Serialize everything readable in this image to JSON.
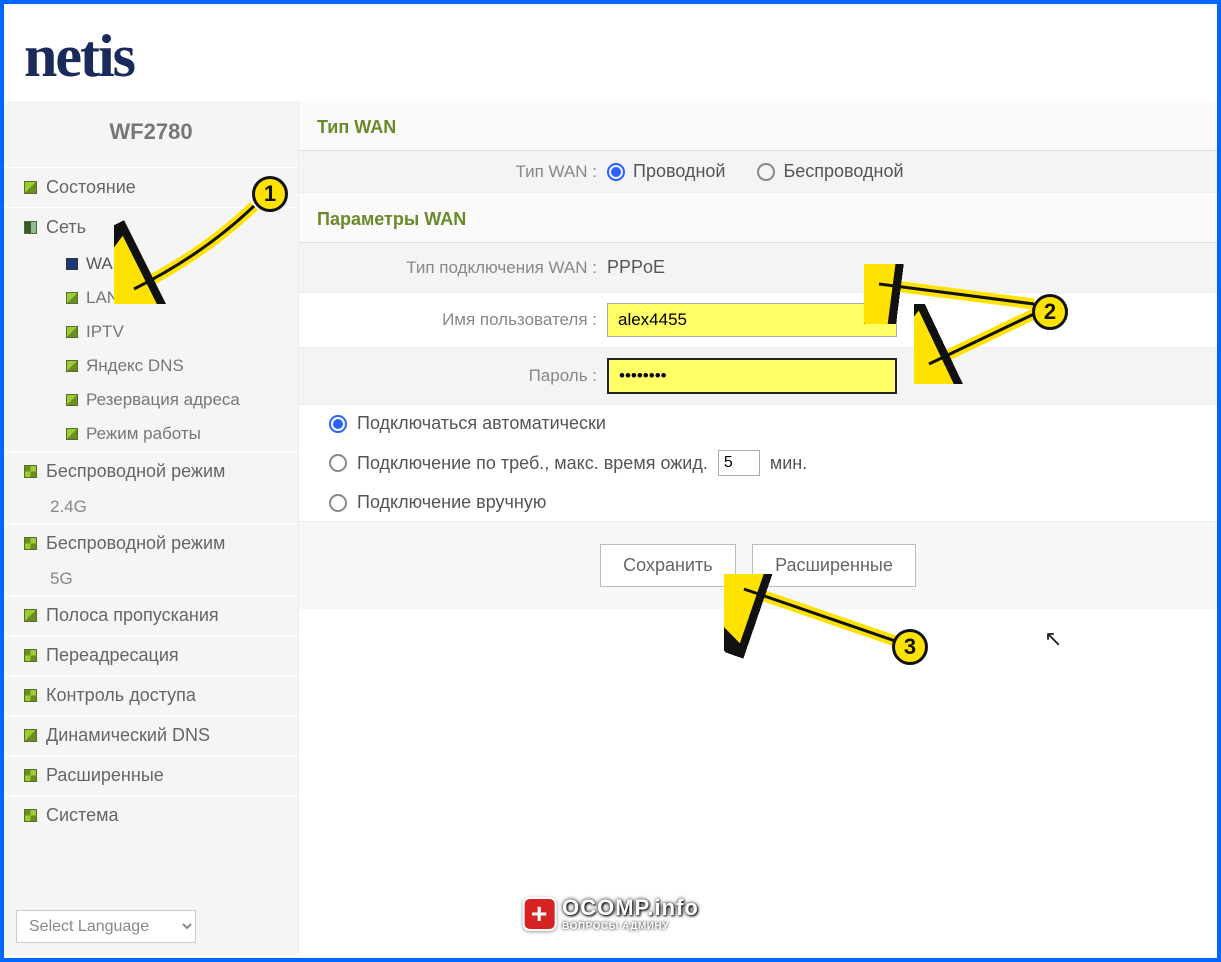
{
  "logo": "netis",
  "model": "WF2780",
  "sidebar": {
    "status": "Состояние",
    "network": "Сеть",
    "network_items": [
      "WAN",
      "LAN",
      "IPTV",
      "Яндекс DNS",
      "Резервация адреса",
      "Режим работы"
    ],
    "wireless24": "Беспроводной режим",
    "wireless24_sub": "2.4G",
    "wireless5": "Беспроводной режим",
    "wireless5_sub": "5G",
    "bandwidth": "Полоса пропускания",
    "forward": "Переадресация",
    "access": "Контроль доступа",
    "ddns": "Динамический DNS",
    "advanced": "Расширенные",
    "system": "Система",
    "lang": "Select Language"
  },
  "wan_type_section": "Тип WAN",
  "wan_type_label": "Тип WAN :",
  "wan_type_opts": {
    "wired": "Проводной",
    "wireless": "Беспроводной"
  },
  "wan_params_section": "Параметры WAN",
  "conn_type_label": "Тип подключения WAN :",
  "conn_type_value": "PPPoE",
  "username_label": "Имя пользователя :",
  "username_value": "alex4455",
  "password_label": "Пароль :",
  "password_value": "••••••••",
  "auto_connect": "Подключаться автоматически",
  "on_demand_prefix": "Подключение по треб., макс. время ожид.",
  "on_demand_value": "5",
  "on_demand_suffix": "мин.",
  "manual_connect": "Подключение вручную",
  "btn_save": "Сохранить",
  "btn_adv": "Расширенные",
  "badges": {
    "1": "1",
    "2": "2",
    "3": "3"
  },
  "watermark": {
    "main": "OCOMP.info",
    "sub": "ВОПРОСЫ АДМИНУ"
  }
}
